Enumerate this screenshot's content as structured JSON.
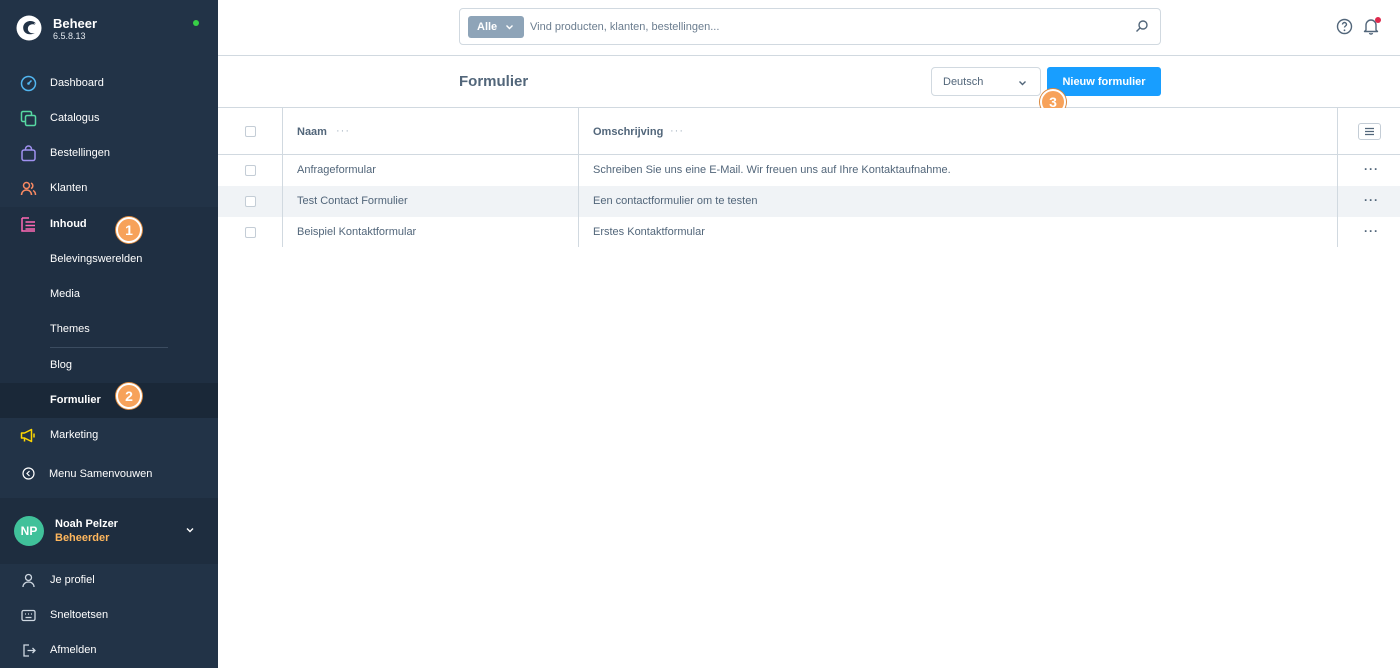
{
  "brand": {
    "name": "Beheer",
    "version": "6.5.8.13"
  },
  "nav": {
    "items": [
      {
        "label": "Dashboard",
        "icon": "dashboard-icon"
      },
      {
        "label": "Catalogus",
        "icon": "catalog-icon"
      },
      {
        "label": "Bestellingen",
        "icon": "shopping-bag-icon"
      },
      {
        "label": "Klanten",
        "icon": "customers-icon"
      },
      {
        "label": "Inhoud",
        "icon": "content-icon"
      },
      {
        "label": "Marketing",
        "icon": "megaphone-icon"
      }
    ],
    "sub_items": [
      {
        "label": "Belevingswerelden"
      },
      {
        "label": "Media"
      },
      {
        "label": "Themes"
      },
      {
        "label": "Blog"
      },
      {
        "label": "Formulier"
      }
    ],
    "collapse_label": "Menu Samenvouwen"
  },
  "user": {
    "initials": "NP",
    "name": "Noah Pelzer",
    "role": "Beheerder"
  },
  "bottom_menu": [
    {
      "label": "Je profiel",
      "icon": "user-icon"
    },
    {
      "label": "Sneltoetsen",
      "icon": "keyboard-icon"
    },
    {
      "label": "Afmelden",
      "icon": "logout-icon"
    }
  ],
  "search": {
    "type_label": "Alle",
    "placeholder": "Vind producten, klanten, bestellingen..."
  },
  "smartbar": {
    "title": "Formulier",
    "language": "Deutsch",
    "primary_button": "Nieuw formulier"
  },
  "badges": [
    "1",
    "2",
    "3"
  ],
  "grid": {
    "columns": [
      "Naam",
      "Omschrijving"
    ],
    "rows": [
      {
        "name": "Anfrageformular",
        "description": "Schreiben Sie uns eine E-Mail. Wir freuen uns auf Ihre Kontaktaufnahme."
      },
      {
        "name": "Test Contact Formulier",
        "description": "Een contactformulier om te testen"
      },
      {
        "name": "Beispiel Kontaktformular",
        "description": "Erstes Kontaktformular"
      }
    ],
    "row_actions_glyph": "···",
    "column_actions_glyph": "···"
  },
  "colors": {
    "sidebar": "#223347",
    "primary": "#189eff",
    "badge": "#f7a25a",
    "status_online": "#37d046",
    "notification": "#de294c",
    "role": "#ffb75d"
  }
}
